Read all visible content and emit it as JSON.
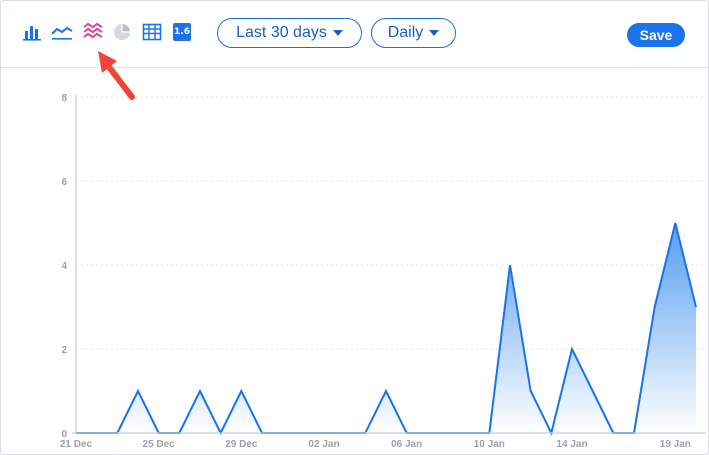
{
  "toolbar": {
    "icons": [
      {
        "name": "bar-chart-icon",
        "active": false
      },
      {
        "name": "line-chart-icon",
        "active": false
      },
      {
        "name": "stacked-area-chart-icon",
        "active": true
      },
      {
        "name": "pie-chart-icon",
        "active": false,
        "disabled": true
      },
      {
        "name": "table-icon",
        "active": false
      },
      {
        "name": "number-icon",
        "label": "1.6",
        "active": false
      }
    ],
    "range_label": "Last 30 days",
    "interval_label": "Daily",
    "save_label": "Save"
  },
  "colors": {
    "accent": "#1a73e8",
    "active_icon": "#e83e8c",
    "disabled_icon": "#c7cbd1",
    "annotation_arrow": "#f04438",
    "area_line": "#1a73e8",
    "area_fill_top": "#4a97ef",
    "area_fill_bottom": "#ffffff"
  },
  "chart_data": {
    "type": "area",
    "x": [
      "21 Dec",
      "22 Dec",
      "23 Dec",
      "24 Dec",
      "25 Dec",
      "26 Dec",
      "27 Dec",
      "28 Dec",
      "29 Dec",
      "30 Dec",
      "31 Dec",
      "01 Jan",
      "02 Jan",
      "03 Jan",
      "04 Jan",
      "05 Jan",
      "06 Jan",
      "07 Jan",
      "08 Jan",
      "09 Jan",
      "10 Jan",
      "11 Jan",
      "12 Jan",
      "13 Jan",
      "14 Jan",
      "15 Jan",
      "16 Jan",
      "17 Jan",
      "18 Jan",
      "19 Jan",
      "20 Jan"
    ],
    "values": [
      0,
      0,
      0,
      1,
      0,
      0,
      1,
      0,
      1,
      0,
      0,
      0,
      0,
      0,
      0,
      1,
      0,
      0,
      0,
      0,
      0,
      4,
      1,
      0,
      2,
      1,
      0,
      0,
      3,
      5,
      3
    ],
    "x_tick_labels": [
      "21 Dec",
      "25 Dec",
      "29 Dec",
      "02 Jan",
      "06 Jan",
      "10 Jan",
      "14 Jan",
      "19 Jan"
    ],
    "y_ticks": [
      0,
      2,
      4,
      6,
      8
    ],
    "ylim": [
      0,
      8
    ],
    "grid": true
  }
}
